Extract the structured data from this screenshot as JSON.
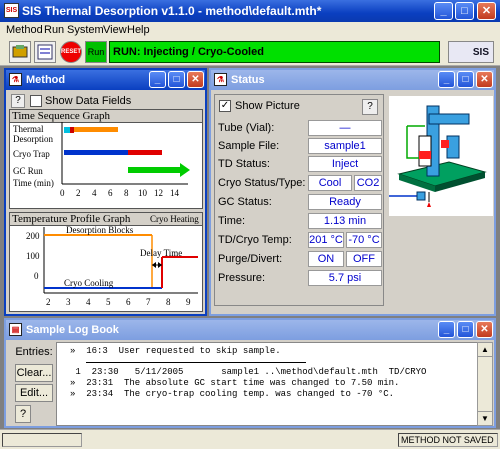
{
  "app": {
    "title": "SIS Thermal Desorption v1.1.0 - method\\default.mth*",
    "icon_text": "SIS"
  },
  "menu": [
    "Method",
    "Run",
    "System",
    "View",
    "Help"
  ],
  "toolbar": {
    "buttons": [
      {
        "name": "method-tool-icon",
        "text": ""
      },
      {
        "name": "batch-tool-icon",
        "text": ""
      },
      {
        "name": "reset-button",
        "text": "RESET"
      },
      {
        "name": "run-button",
        "text": "Run"
      }
    ],
    "run_status": "RUN: Injecting / Cryo-Cooled",
    "logo": "SIS"
  },
  "method_panel": {
    "title": "Method",
    "show_data_fields_label": "Show Data Fields",
    "help": "?",
    "sequence_title": "Time Sequence Graph",
    "sequence_rows": [
      "Thermal",
      "Desorption",
      "Cryo Trap",
      "GC Run",
      "Time (min)"
    ],
    "sequence_ticks": [
      "0",
      "2",
      "4",
      "6",
      "8",
      "10",
      "12",
      "14"
    ],
    "profile_title": "Temperature Profile Graph",
    "profile_state": "Cryo Heating",
    "profile_labels": {
      "desorption": "Desorption Blocks",
      "delay": "Delay Time",
      "cooling": "Cryo Cooling"
    },
    "profile_yticks": [
      "200",
      "100",
      "0"
    ],
    "profile_xticks": [
      "2",
      "3",
      "4",
      "5",
      "6",
      "7",
      "8",
      "9"
    ],
    "colors": {
      "thermal": "#ff8c00",
      "cryo": "#0033cc",
      "gc": "#00cc00",
      "red": "#e00000"
    }
  },
  "status_panel": {
    "title": "Status",
    "show_picture_label": "Show Picture",
    "show_picture_checked": true,
    "help": "?",
    "rows": [
      {
        "label": "Tube (Vial):",
        "values": [
          "—"
        ]
      },
      {
        "label": "Sample File:",
        "values": [
          "sample1"
        ]
      },
      {
        "label": "TD Status:",
        "values": [
          "Inject"
        ]
      },
      {
        "label": "Cryo Status/Type:",
        "values": [
          "Cool",
          "CO2"
        ]
      },
      {
        "label": "GC Status:",
        "values": [
          "Ready"
        ]
      },
      {
        "label": "Time:",
        "values": [
          "1.13 min"
        ]
      },
      {
        "label": "TD/Cryo Temp:",
        "values": [
          "201 °C",
          "-70 °C"
        ]
      },
      {
        "label": "Purge/Divert:",
        "values": [
          "ON",
          "OFF"
        ]
      },
      {
        "label": "Pressure:",
        "values": [
          "5.7 psi"
        ]
      }
    ]
  },
  "log_panel": {
    "title": "Sample Log Book",
    "buttons": [
      "Entries:",
      "Clear...",
      "Edit...",
      "?"
    ],
    "lines": [
      "»  16:3  User requested to skip sample.",
      "",
      " 1  23:30   5/11/2005       sample1 ..\\method\\default.mth  TD/CRYO",
      "»  23:31  The absolute GC start time was changed to 7.50 min.",
      "»  23:34  The cryo-trap cooling temp. was changed to -70 °C."
    ]
  },
  "status_bar": {
    "message": "METHOD NOT SAVED"
  }
}
